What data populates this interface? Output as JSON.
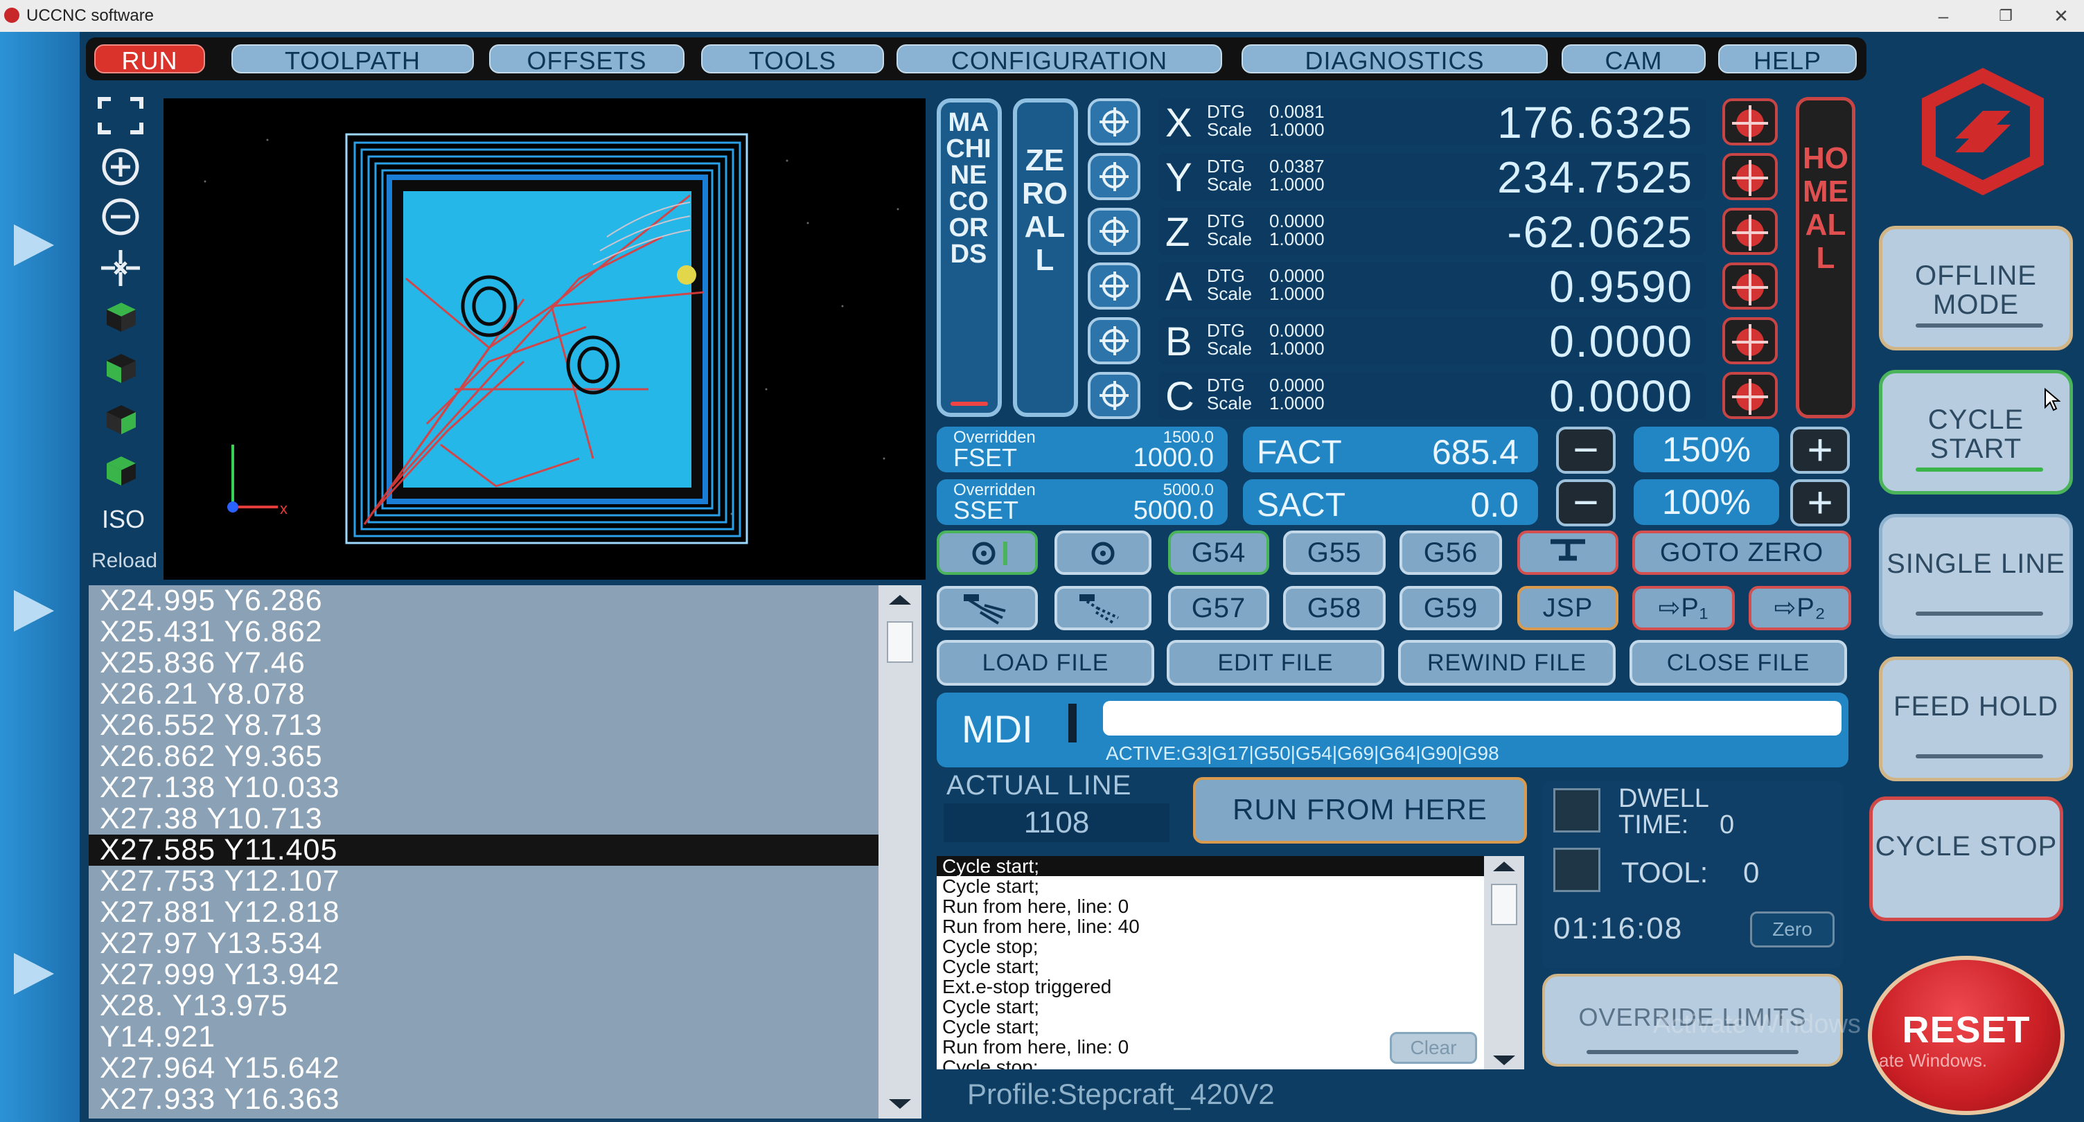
{
  "window": {
    "title": "UCCNC software",
    "min": "–",
    "max": "❐",
    "close": "✕"
  },
  "menu": {
    "tabs": [
      {
        "label": "RUN",
        "active": true
      },
      {
        "label": "TOOLPATH"
      },
      {
        "label": "OFFSETS"
      },
      {
        "label": "TOOLS"
      },
      {
        "label": "CONFIGURATION"
      },
      {
        "label": "DIAGNOSTICS"
      },
      {
        "label": "CAM"
      },
      {
        "label": "HELP"
      }
    ]
  },
  "viewtools": {
    "iso": "ISO",
    "reload": "Reload"
  },
  "gcode": {
    "lines": [
      "X24.995 Y6.286",
      "X25.431 Y6.862",
      "X25.836 Y7.46",
      "X26.21 Y8.078",
      "X26.552 Y8.713",
      "X26.862 Y9.365",
      "X27.138 Y10.033",
      "X27.38 Y10.713",
      "X27.585 Y11.405",
      "X27.753 Y12.107",
      "X27.881 Y12.818",
      "X27.97 Y13.534",
      "X27.999 Y13.942",
      "X28. Y13.975",
      "Y14.921",
      "X27.964 Y15.642",
      "X27.933 Y16.363"
    ],
    "selected_index": 8
  },
  "dro": {
    "machine_coords": "MACHINE COORDS",
    "zero_all": "ZERO ALL",
    "home_all": "HOME ALL",
    "dtg_label": "DTG",
    "scale_label": "Scale",
    "axes": [
      {
        "letter": "X",
        "dtg": "0.0081",
        "scale": "1.0000",
        "value": "176.6325"
      },
      {
        "letter": "Y",
        "dtg": "0.0387",
        "scale": "1.0000",
        "value": "234.7525"
      },
      {
        "letter": "Z",
        "dtg": "0.0000",
        "scale": "1.0000",
        "value": "-62.0625"
      },
      {
        "letter": "A",
        "dtg": "0.0000",
        "scale": "1.0000",
        "value": "0.9590"
      },
      {
        "letter": "B",
        "dtg": "0.0000",
        "scale": "1.0000",
        "value": "0.0000"
      },
      {
        "letter": "C",
        "dtg": "0.0000",
        "scale": "1.0000",
        "value": "0.0000"
      }
    ]
  },
  "feed": {
    "overridden_label": "Overridden",
    "fset_label": "FSET",
    "fset_override": "1500.0",
    "fset_value": "1000.0",
    "fact_label": "FACT",
    "fact_value": "685.4",
    "feed_override": "150%"
  },
  "spindle": {
    "overridden_label": "Overridden",
    "sset_label": "SSET",
    "sset_override": "5000.0",
    "sset_value": "5000.0",
    "sact_label": "SACT",
    "sact_value": "0.0",
    "spindle_override": "100%"
  },
  "controls": {
    "minus": "−",
    "plus": "+",
    "g54": "G54",
    "g55": "G55",
    "g56": "G56",
    "g57": "G57",
    "g58": "G58",
    "g59": "G59",
    "goto_zero": "GOTO ZERO",
    "jsp": "JSP",
    "p1": "⇨P₁",
    "p2": "⇨P₂",
    "load_file": "LOAD FILE",
    "edit_file": "EDIT FILE",
    "rewind_file": "REWIND FILE",
    "close_file": "CLOSE FILE"
  },
  "mdi": {
    "label": "MDI",
    "value": "",
    "active": "ACTIVE:G3|G17|G50|G54|G69|G64|G90|G98"
  },
  "actual_line": {
    "label": "ACTUAL LINE",
    "value": "1108"
  },
  "run_from_here": "RUN FROM HERE",
  "status": {
    "dwell_label": "DWELL",
    "dwell_time_label": "TIME:",
    "dwell_time": "0",
    "tool_label": "TOOL:",
    "tool": "0",
    "timer": "01:16:08",
    "zero_label": "Zero"
  },
  "log": {
    "lines": [
      "Cycle start;",
      "Cycle start;",
      "Run from here, line: 0",
      "Run from here, line: 40",
      "Cycle stop;",
      "Cycle start;",
      "Ext.e-stop triggered",
      "Cycle start;",
      "Cycle start;",
      "Run from here, line: 0",
      "Cycle stop;"
    ],
    "clear_label": "Clear"
  },
  "override_limits": "OVERRIDE LIMITS",
  "profile": "Profile:Stepcraft_420V2",
  "side": {
    "offline_mode": "OFFLINE MODE",
    "cycle_start": "CYCLE START",
    "single_line": "SINGLE LINE",
    "feed_hold": "FEED HOLD",
    "cycle_stop": "CYCLE STOP",
    "reset": "RESET"
  },
  "watermark": {
    "line1": "Activate Windows",
    "line2": "ate Windows."
  },
  "colors": {
    "accent": "#2286c5",
    "run_tab": "#d9332b",
    "reset": "#c81e24",
    "toolpath_blue": "#23b6e6",
    "toolpath_red": "#e23b3b"
  }
}
